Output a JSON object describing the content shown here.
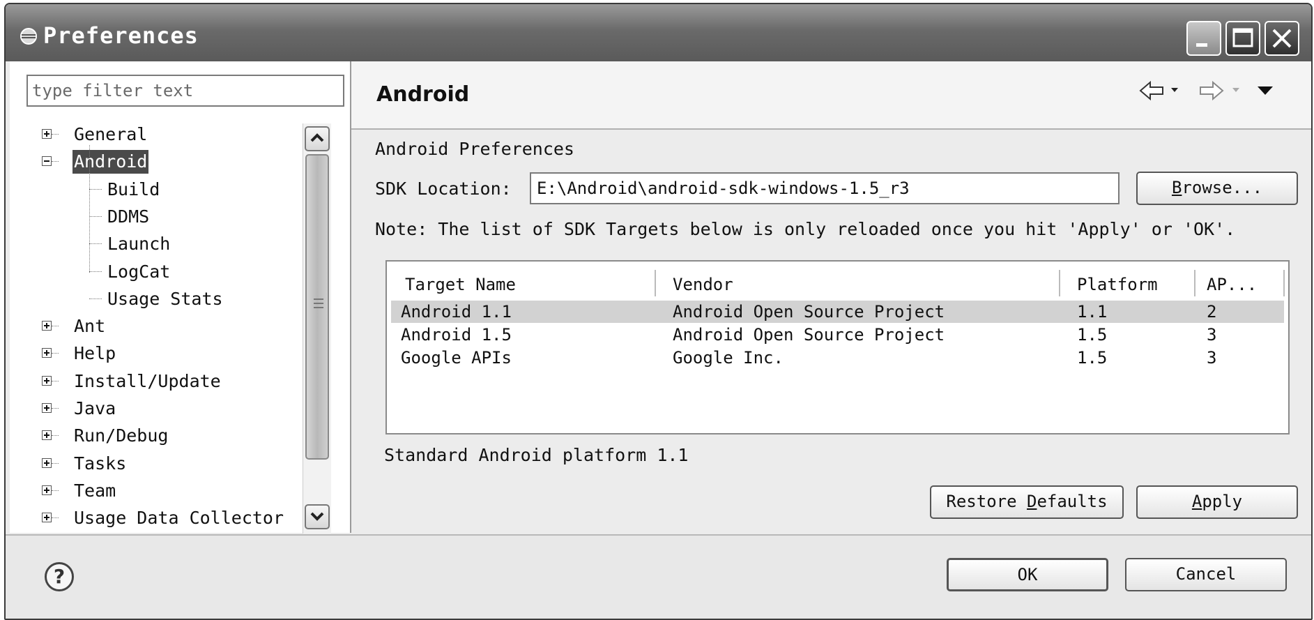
{
  "window": {
    "title": "Preferences",
    "controls": [
      "minimize-icon",
      "maximize-icon",
      "close-icon"
    ]
  },
  "sidebar": {
    "filter_placeholder": "type filter text",
    "tree": [
      {
        "label": "General",
        "level": 0,
        "state": "collapsed"
      },
      {
        "label": "Android",
        "level": 0,
        "state": "expanded",
        "selected": true
      },
      {
        "label": "Build",
        "level": 1
      },
      {
        "label": "DDMS",
        "level": 1
      },
      {
        "label": "Launch",
        "level": 1
      },
      {
        "label": "LogCat",
        "level": 1
      },
      {
        "label": "Usage Stats",
        "level": 1
      },
      {
        "label": "Ant",
        "level": 0,
        "state": "collapsed"
      },
      {
        "label": "Help",
        "level": 0,
        "state": "collapsed"
      },
      {
        "label": "Install/Update",
        "level": 0,
        "state": "collapsed"
      },
      {
        "label": "Java",
        "level": 0,
        "state": "collapsed"
      },
      {
        "label": "Run/Debug",
        "level": 0,
        "state": "collapsed"
      },
      {
        "label": "Tasks",
        "level": 0,
        "state": "collapsed"
      },
      {
        "label": "Team",
        "level": 0,
        "state": "collapsed"
      },
      {
        "label": "Usage Data Collector",
        "level": 0,
        "state": "collapsed"
      }
    ]
  },
  "page": {
    "title": "Android",
    "nav_icons": [
      "back-arrow-icon",
      "dropdown-icon",
      "forward-arrow-icon",
      "dropdown-icon",
      "view-menu-icon"
    ],
    "section_label": "Android Preferences",
    "sdk_label": "SDK Location:",
    "sdk_value": "E:\\Android\\android-sdk-windows-1.5_r3",
    "browse_button": "Browse...",
    "note": "Note: The list of SDK Targets below is only reloaded once you hit 'Apply' or 'OK'.",
    "table": {
      "columns": [
        "Target Name",
        "Vendor",
        "Platform",
        "AP..."
      ],
      "rows": [
        {
          "name": "Android 1.1",
          "vendor": "Android Open Source Project",
          "platform": "1.1",
          "api": "2",
          "selected": true
        },
        {
          "name": "Android 1.5",
          "vendor": "Android Open Source Project",
          "platform": "1.5",
          "api": "3"
        },
        {
          "name": "Google APIs",
          "vendor": "Google Inc.",
          "platform": "1.5",
          "api": "3"
        }
      ]
    },
    "description": "Standard Android platform 1.1",
    "restore_defaults_button": "Restore Defaults",
    "apply_button": "Apply"
  },
  "footer": {
    "help_icon": "help-icon",
    "ok_button": "OK",
    "cancel_button": "Cancel"
  }
}
